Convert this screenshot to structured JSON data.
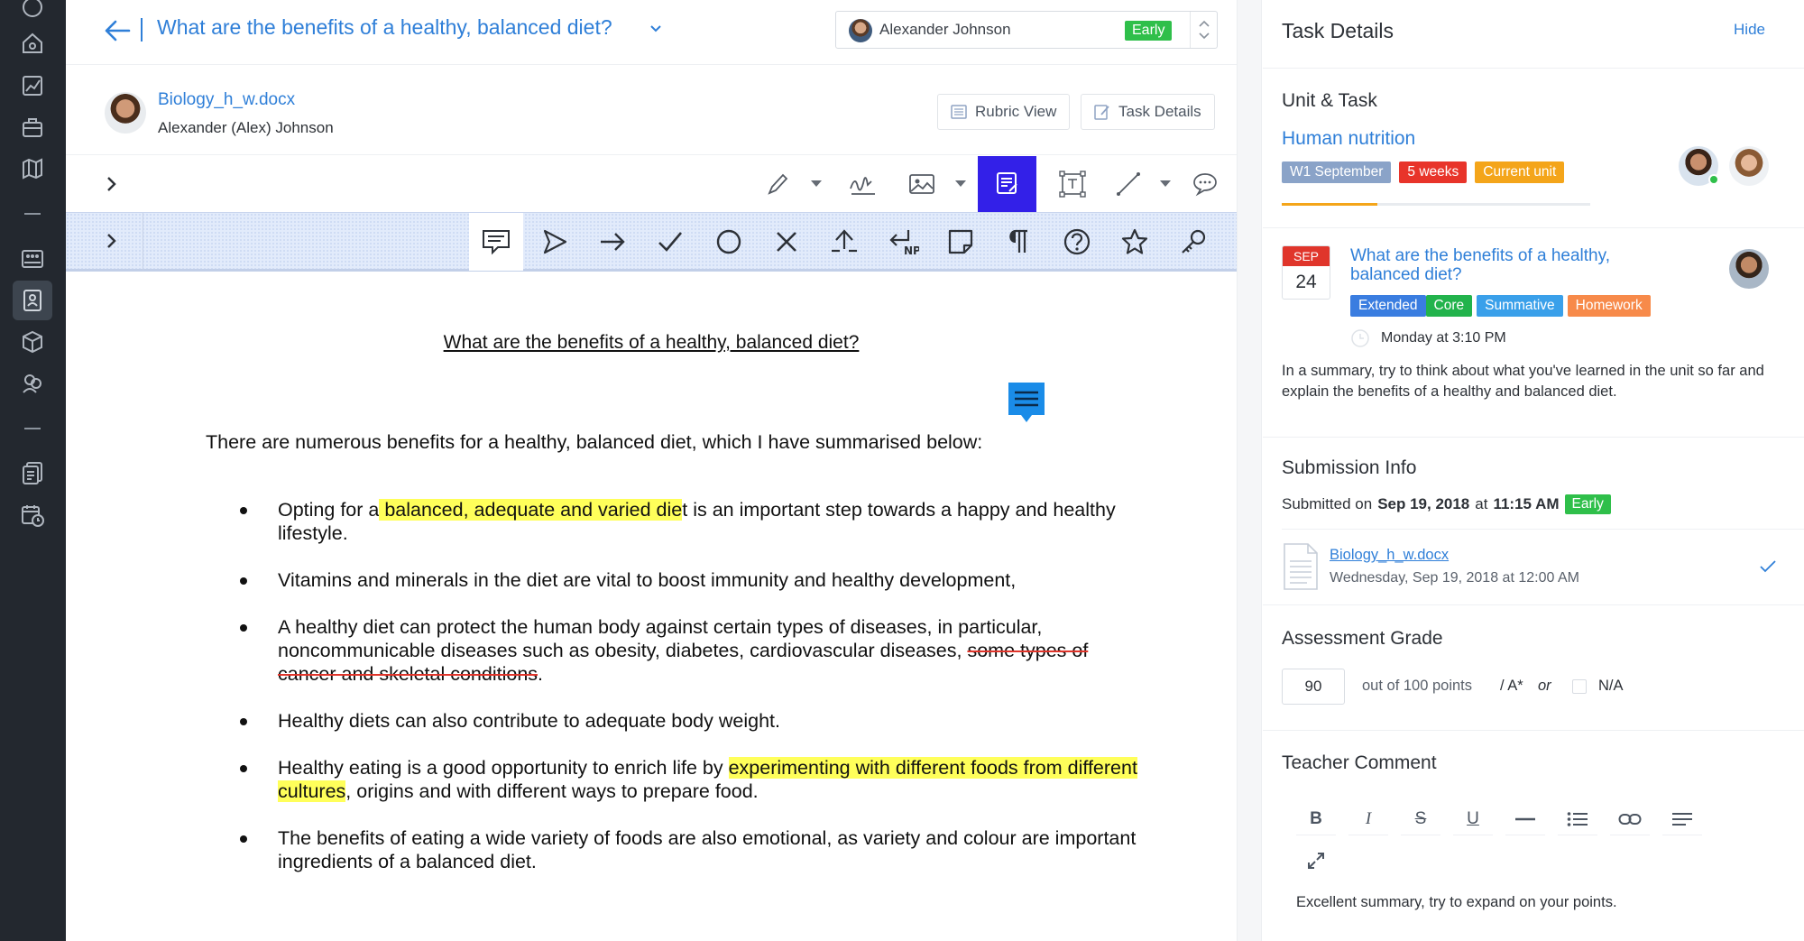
{
  "header": {
    "task_title": "What are the benefits of a healthy, balanced diet?",
    "student_name": "Alexander Johnson",
    "student_status": "Early"
  },
  "doc_info": {
    "file_name": "Biology_h_w.docx",
    "student_full_name": "Alexander (Alex) Johnson",
    "rubric_view_label": "Rubric View",
    "task_details_label": "Task Details"
  },
  "document": {
    "heading": "What are the benefits of a healthy, balanced diet?",
    "intro": "There are numerous benefits for a healthy, balanced diet, which I have summarised below:",
    "bullets": [
      {
        "pre": "Opting for a",
        "highlight": " balanced, adequate and varied die",
        "post": "t is an important step towards a happy and healthy lifestyle."
      },
      {
        "text": "Vitamins and minerals in the diet are vital to boost immunity and healthy development,"
      },
      {
        "pre": "A healthy diet can protect the human body against certain types of diseases, in particular, noncommunicable diseases such as obesity, diabetes, cardiovascular diseases, ",
        "strike": "some types of cancer and skeletal conditions",
        "post": "."
      },
      {
        "text": "Healthy diets can also contribute to adequate body weight."
      },
      {
        "pre": "Healthy eating is a good opportunity to enrich life by ",
        "highlight": "experimenting with different foods from different cultures",
        "post": ", origins and with different ways to prepare food."
      },
      {
        "text": "The benefits of eating a wide variety of foods are also emotional, as variety and colour are important ingredients of a balanced diet."
      }
    ]
  },
  "panel": {
    "title": "Task Details",
    "hide_label": "Hide",
    "unit_heading": "Unit & Task",
    "unit_name": "Human nutrition",
    "unit_tags": [
      "W1 September",
      "5 weeks",
      "Current unit"
    ],
    "unit_progress": 0.31,
    "date_month": "SEP",
    "date_day": "24",
    "task_link": "What are the benefits of a healthy, balanced diet?",
    "task_tags": [
      "Extended",
      "Core",
      "Summative",
      "Homework"
    ],
    "due": "Monday at 3:10 PM",
    "description": "In a summary,  try to think about what you've learned in the unit so far and explain the benefits of a healthy and balanced diet.",
    "submission_heading": "Submission Info",
    "submitted_prefix": "Submitted on",
    "submitted_date": "Sep 19, 2018",
    "submitted_at": "at",
    "submitted_time": "11:15 AM",
    "submitted_status": "Early",
    "file_name": "Biology_h_w.docx",
    "file_date": "Wednesday, Sep 19, 2018 at 12:00 AM",
    "grade_heading": "Assessment Grade",
    "grade_value": "90",
    "grade_out_of": "out of 100 points",
    "grade_letter": "/ A*",
    "grade_or": "or",
    "grade_na": "N/A",
    "comment_heading": "Teacher Comment",
    "comment_text": "Excellent summary, try to expand on your points."
  },
  "colors": {
    "accent": "#2f7fd8",
    "active_tool": "#3320e8",
    "early": "#2fbf4a",
    "unit_tag_1": "#8aa3c8",
    "unit_tag_2": "#e8342a",
    "unit_tag_3": "#f4a51a",
    "extended": "#3a7de0",
    "core": "#22b34c",
    "summative": "#3aa0ea",
    "homework": "#f78a4a"
  }
}
